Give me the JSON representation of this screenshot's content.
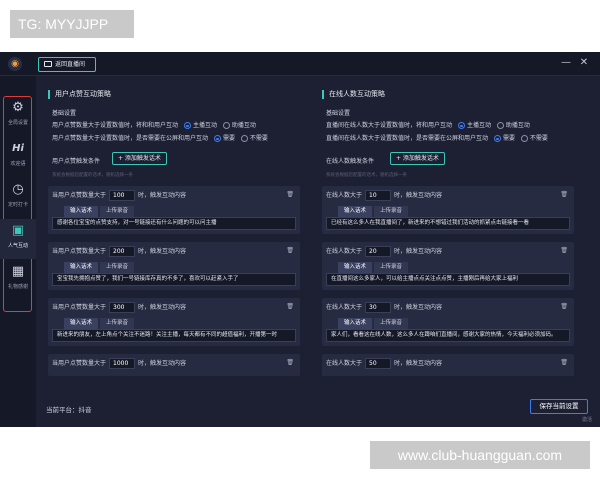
{
  "watermark": {
    "top": "TG: MYYJJPP",
    "bottom": "www.club-huangguan.com"
  },
  "titlebar": {
    "back_label": "返回直播间",
    "minimize": "—",
    "close": "✕"
  },
  "sidebar": {
    "items": [
      {
        "icon": "gear-icon",
        "glyph": "⚙",
        "label": "全局设置"
      },
      {
        "icon": "hi-icon",
        "glyph": "Hi",
        "label": "欢迎语"
      },
      {
        "icon": "clock-icon",
        "glyph": "◷",
        "label": "定时打卡"
      },
      {
        "icon": "chat-icon",
        "glyph": "▣",
        "label": "人气互动"
      },
      {
        "icon": "gift-icon",
        "glyph": "▦",
        "label": "礼物感谢"
      }
    ],
    "active_index": 3
  },
  "left": {
    "title": "用户点赞互动策略",
    "basic_label": "基础设置",
    "row1": {
      "text": "用户点赞数量大于设置数值时，将和和用户互动",
      "opt1": "主播互动",
      "opt2": "助播互动"
    },
    "row2": {
      "text": "用户点赞数量大于设置数值时，是否需要在公屏和用户互动",
      "opt1": "需要",
      "opt2": "不需要"
    },
    "cond_label": "用户点赞触发条件",
    "add_label": "+ 添加触发话术",
    "hint": "系统会根据您配置的话术，随机选择一条",
    "cards": [
      {
        "prefix": "当用户点赞数量大于",
        "value": "100",
        "suffix": "时，触发互动内容",
        "tab1": "输入话术",
        "tab2": "上传录音",
        "script": "感谢各位宝宝的点赞支持，对一号链接还有什么问题的可以问主播"
      },
      {
        "prefix": "当用户点赞数量大于",
        "value": "200",
        "suffix": "时，触发互动内容",
        "tab1": "输入话术",
        "tab2": "上传录音",
        "script": "宝宝我先拥抱点赞了，我们一号链接库存真的不多了，喜欢可以赶紧入手了"
      },
      {
        "prefix": "当用户点赞数量大于",
        "value": "300",
        "suffix": "时，触发互动内容",
        "tab1": "输入话术",
        "tab2": "上传录音",
        "script": "新进来的朋友，左上角点个关注不迷路！关注主播，每天都有不同的超值福利，开播第一时"
      },
      {
        "prefix": "当用户点赞数量大于",
        "value": "1000",
        "suffix": "时，触发互动内容"
      }
    ]
  },
  "right": {
    "title": "在线人数互动策略",
    "basic_label": "基础设置",
    "row1": {
      "text": "直播间在线人数大于设置数值时，将和用户互动",
      "opt1": "主播互动",
      "opt2": "助播互动"
    },
    "row2": {
      "text": "直播间在线人数大于设置数值时，是否需要在公屏和用户互动",
      "opt1": "需要",
      "opt2": "不需要"
    },
    "cond_label": "在线人数触发条件",
    "add_label": "+ 添加触发话术",
    "hint": "系统会根据您配置的话术，随机选择一条",
    "cards": [
      {
        "prefix": "在线人数大于",
        "value": "10",
        "suffix": "时，触发互动内容",
        "tab1": "输入话术",
        "tab2": "上传录音",
        "script": "已经有这么多人在我直播间了，新进来的不想错过我们活动的抓紧点击链接看一看"
      },
      {
        "prefix": "在线人数大于",
        "value": "20",
        "suffix": "时，触发互动内容",
        "tab1": "输入话术",
        "tab2": "上传录音",
        "script": "在直播间这么多家人，可以给主播点点关注点点赞，主播刚后再给大家上福利"
      },
      {
        "prefix": "在线人数大于",
        "value": "30",
        "suffix": "时，触发互动内容",
        "tab1": "输入话术",
        "tab2": "上传录音",
        "script": "家人们，看看这在线人数，这么多人在蹲咱们直播间，感谢大家的热情，今天福利必须加码。"
      },
      {
        "prefix": "在线人数大于",
        "value": "50",
        "suffix": "时，触发互动内容"
      }
    ]
  },
  "footer": {
    "platform": "当前平台：抖音",
    "save": "保存当前设置",
    "activate": "激活"
  },
  "colors": {
    "accent": "#3ec7b8",
    "primary": "#3d7cf0",
    "highlight": "#e03a3a",
    "bg": "#1d2033"
  }
}
